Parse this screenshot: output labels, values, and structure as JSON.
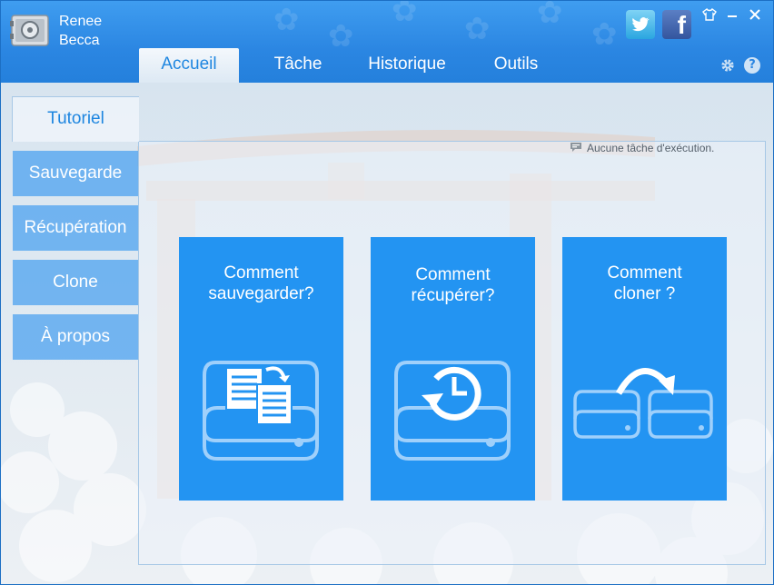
{
  "app": {
    "brand_line1": "Renee",
    "brand_line2": "Becca"
  },
  "header": {
    "tabs": [
      {
        "label": "Accueil",
        "active": true
      },
      {
        "label": "Tâche",
        "active": false
      },
      {
        "label": "Historique",
        "active": false
      },
      {
        "label": "Outils",
        "active": false
      }
    ],
    "icons": [
      "twitter-icon",
      "facebook-icon",
      "skin-icon",
      "minimize-icon",
      "close-icon",
      "settings-icon",
      "help-icon"
    ]
  },
  "sidebar": {
    "tutorial_label": "Tutoriel",
    "items": [
      {
        "label": "Sauvegarde"
      },
      {
        "label": "Récupération"
      },
      {
        "label": "Clone"
      },
      {
        "label": "À propos"
      }
    ]
  },
  "status": {
    "text": "Aucune tâche d'exécution."
  },
  "cards": [
    {
      "line1": "Comment",
      "line2": "sauvegarder?",
      "icon": "backup-drive-icon"
    },
    {
      "line1": "Comment",
      "line2": "récupérer?",
      "icon": "restore-drive-icon"
    },
    {
      "line1": "Comment",
      "line2": "cloner ?",
      "icon": "clone-drives-icon"
    }
  ],
  "colors": {
    "header_blue": "#2b86e2",
    "card_blue": "#2394f2",
    "accent_text": "#1e86e0",
    "sidebar_button": "#46a0f0"
  }
}
